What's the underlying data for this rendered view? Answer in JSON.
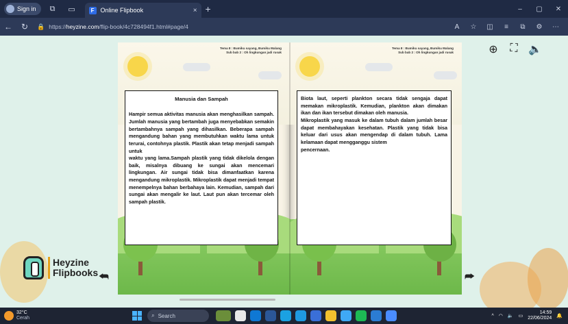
{
  "browser": {
    "signin_label": "Sign in",
    "tab_title": "Online Flipbook",
    "tab_close": "×",
    "new_tab": "+",
    "window_controls": [
      "–",
      "▢",
      "✕"
    ],
    "url_prefix": "https://",
    "url_domain": "heyzine.com",
    "url_path": "/flip-book/4c728494f1.html#page/4"
  },
  "viewer": {
    "zoom_icon": "⊕",
    "fullscreen_icon": "⛶",
    "sound_icon": "🔈"
  },
  "left_page": {
    "header_line1": "Tema 8 : Bumiku sayang, Bumiku Malang",
    "header_line2": "Sub bab 2 : Oh lingkungan jadi rusak",
    "title": "Manusia dan Sampah",
    "paragraphs": [
      "Hampir semua aktivitas manusia akan menghasilkan sampah. Jumlah manusia yang bertambah juga menyebabkan semakin bertambahnya sampah yang dihasilkan. Beberapa sampah mengandung bahan yang membutuhkan waktu lama untuk terurai, contohnya plastik. Plastik akan tetap menjadi sampah untuk",
      "waktu yang lama.Sampah plastik yang tidak dikelola dengan baik, misalnya dibuang ke sungai akan mencemari lingkungan. Air sungai tidak bisa dimanfaatkan karena mengandung mikroplastik. Mikroplastik dapat menjadi tempat menempelnya bahan berbahaya lain. Kemudian, sampah dari sungai akan mengalir ke laut. Laut pun akan tercemar oleh sampah plastik."
    ]
  },
  "right_page": {
    "header_line1": "Tema 8 : Bumiku sayang, Bumiku Malang",
    "header_line2": "Sub bab 2 : Oh lingkungan jadi rusak",
    "paragraphs": [
      "Biota laut, seperti plankton secara tidak sengaja dapat memakan mikroplastik. Kemudian, plankton akan dimakan ikan dan ikan tersebut dimakan oleh manusia.",
      "Mikroplastik yang masuk ke dalam tubuh dalam jumlah besar dapat membahayakan kesehatan. Plastik yang tidak bisa keluar dari usus akan mengendap di dalam tubuh. Lama kelamaan dapat mengganggu sistem",
      "pencernaan."
    ]
  },
  "logo": {
    "line1": "Heyzine",
    "line2": "Flipbooks"
  },
  "nav": {
    "prev_icon": "⮪",
    "next_icon": "⮫"
  },
  "taskbar": {
    "temperature": "32°C",
    "condition": "Cerah",
    "search_placeholder": "Search",
    "time": "14:59",
    "date": "22/06/2024"
  }
}
